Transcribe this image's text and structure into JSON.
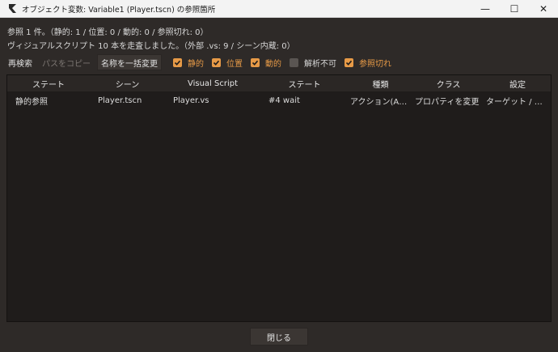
{
  "window": {
    "title": "オブジェクト変数: Variable1 (Player.tscn) の参照箇所",
    "minimize_glyph": "—",
    "maximize_glyph": "☐",
    "close_glyph": "✕"
  },
  "summary": {
    "line1": "参照 1 件。（静的: 1 / 位置: 0 / 動的: 0 / 参照切れ: 0）",
    "line2": "ヴィジュアルスクリプト 10 本を走査しました。（外部 .vs: 9 / シーン内蔵: 0）"
  },
  "toolbar": {
    "rescan": "再検索",
    "copy_path": "パスをコピー",
    "rename_all": "名称を一括変更",
    "filters": [
      {
        "label": "静的",
        "checked": true
      },
      {
        "label": "位置",
        "checked": true
      },
      {
        "label": "動的",
        "checked": true
      },
      {
        "label": "解析不可",
        "checked": false
      },
      {
        "label": "参照切れ",
        "checked": true
      }
    ]
  },
  "table": {
    "columns": [
      "ステート",
      "シーン",
      "Visual Script",
      "ステート",
      "種類",
      "クラス",
      "設定"
    ],
    "rows": [
      [
        "静的参照",
        "Player.tscn",
        "Player.vs",
        "#4 wait",
        "アクション(A…",
        "プロパティを変更",
        "ターゲット / …"
      ]
    ]
  },
  "footer": {
    "close": "閉じる"
  },
  "colors": {
    "accent": "#e79a47",
    "background": "#2e2a28",
    "panel": "#1f1c1b"
  }
}
